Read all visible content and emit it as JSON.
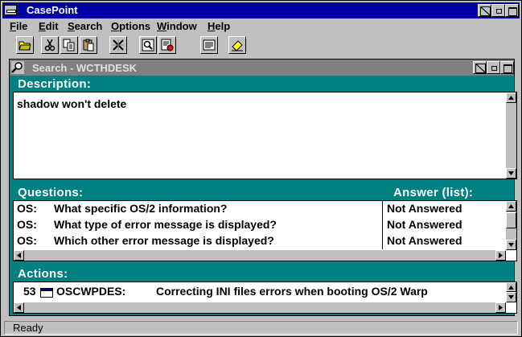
{
  "window": {
    "title": "CasePoint"
  },
  "menu": [
    {
      "label": "File",
      "mnemonic": "F"
    },
    {
      "label": "Edit",
      "mnemonic": "E"
    },
    {
      "label": "Search",
      "mnemonic": "S"
    },
    {
      "label": "Options",
      "mnemonic": "O"
    },
    {
      "label": "Window",
      "mnemonic": "W"
    },
    {
      "label": "Help",
      "mnemonic": "H"
    }
  ],
  "toolbar": [
    {
      "icon": "open-folder-icon"
    },
    {
      "icon": "cut-icon"
    },
    {
      "icon": "copy-icon"
    },
    {
      "icon": "paste-icon"
    },
    {
      "icon": "clear-icon"
    },
    {
      "icon": "find-icon"
    },
    {
      "icon": "stop-search-icon"
    },
    {
      "icon": "notes-icon"
    },
    {
      "icon": "eraser-icon"
    }
  ],
  "child": {
    "title": "Search - WCTHDESK",
    "description_label": "Description:",
    "description_text": "shadow won't delete",
    "questions_label": "Questions:",
    "answer_label": "Answer (list):",
    "questions": [
      {
        "prefix": "OS:",
        "question": "What specific OS/2 information?",
        "answer": "Not Answered"
      },
      {
        "prefix": "OS:",
        "question": "What type of error message is displayed?",
        "answer": "Not Answered"
      },
      {
        "prefix": "OS:",
        "question": "Which other error message is displayed?",
        "answer": "Not Answered"
      }
    ],
    "actions_label": "Actions:",
    "actions": [
      {
        "score": "53",
        "code": "OSCWPDES:",
        "text": "Correcting INI files errors when booting OS/2 Warp"
      }
    ]
  },
  "status": {
    "text": "Ready"
  },
  "colors": {
    "titlebar": "#0000a8",
    "child_bg": "#008080",
    "inactive_title": "#808080"
  }
}
